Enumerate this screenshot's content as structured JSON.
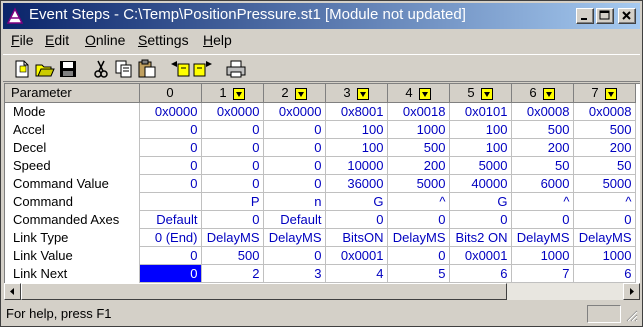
{
  "window": {
    "title": "Event Steps - C:\\Temp\\PositionPressure.st1 [Module not updated]"
  },
  "menu": [
    "File",
    "Edit",
    "Online",
    "Settings",
    "Help"
  ],
  "toolbar": [
    "new-file-icon",
    "open-folder-icon",
    "save-disk-icon",
    "cut-icon",
    "copy-icon",
    "paste-icon",
    "step-left-icon",
    "step-right-icon",
    "print-icon"
  ],
  "grid": {
    "corner_label": "Parameter",
    "columns": [
      "0",
      "1",
      "2",
      "3",
      "4",
      "5",
      "6",
      "7"
    ],
    "rows": [
      {
        "label": "Mode",
        "values": [
          "0x0000",
          "0x0000",
          "0x0000",
          "0x8001",
          "0x0018",
          "0x0101",
          "0x0008",
          "0x0008"
        ]
      },
      {
        "label": "Accel",
        "values": [
          "0",
          "0",
          "0",
          "100",
          "1000",
          "100",
          "500",
          "500"
        ]
      },
      {
        "label": "Decel",
        "values": [
          "0",
          "0",
          "0",
          "100",
          "500",
          "100",
          "200",
          "200"
        ]
      },
      {
        "label": "Speed",
        "values": [
          "0",
          "0",
          "0",
          "10000",
          "200",
          "5000",
          "50",
          "50"
        ]
      },
      {
        "label": "Command Value",
        "values": [
          "0",
          "0",
          "0",
          "36000",
          "5000",
          "40000",
          "6000",
          "5000"
        ]
      },
      {
        "label": "Command",
        "values": [
          "",
          "P",
          "n",
          "G",
          "^",
          "G",
          "^",
          "^"
        ]
      },
      {
        "label": "Commanded Axes",
        "values": [
          "Default",
          "0",
          "Default",
          "0",
          "0",
          "0",
          "0",
          "0"
        ]
      },
      {
        "label": "Link Type",
        "values": [
          "0 (End)",
          "DelayMS",
          "DelayMS",
          "BitsON",
          "DelayMS",
          "Bits2 ON",
          "DelayMS",
          "DelayMS"
        ]
      },
      {
        "label": "Link Value",
        "values": [
          "0",
          "500",
          "0",
          "0x0001",
          "0",
          "0x0001",
          "1000",
          "1000"
        ]
      },
      {
        "label": "Link Next",
        "values": [
          "0",
          "2",
          "3",
          "4",
          "5",
          "6",
          "7",
          "6"
        ]
      }
    ]
  },
  "status": {
    "text": "For help, press F1"
  },
  "colors": {
    "title_gradient_start": "#0a246a",
    "title_gradient_end": "#a6caf0",
    "cell_text": "#0000c0",
    "selection": "#0000ff"
  }
}
